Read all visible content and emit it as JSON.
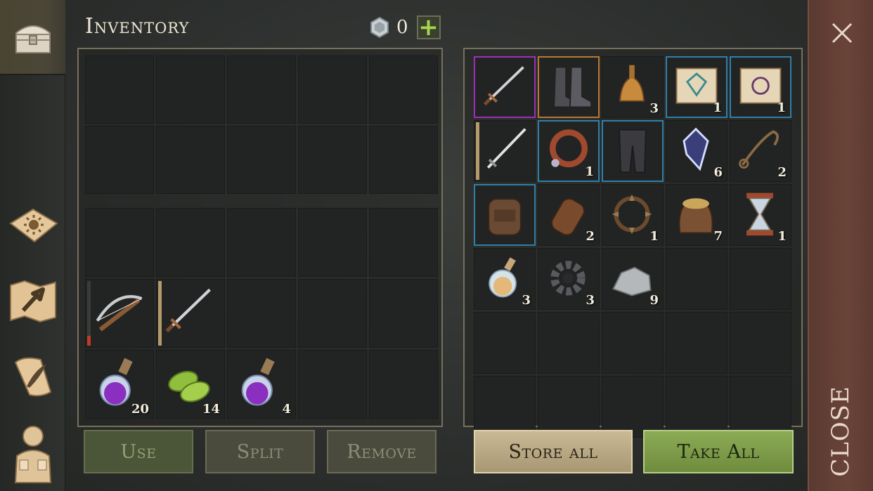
{
  "header": {
    "title": "Inventory",
    "currency_count": "0",
    "add_currency_symbol": "+"
  },
  "sidebar": {
    "items": [
      {
        "name": "inventory",
        "icon": "chest-icon",
        "active": true
      },
      {
        "name": "skills",
        "icon": "sun-book-icon",
        "active": false
      },
      {
        "name": "map",
        "icon": "map-arrow-icon",
        "active": false
      },
      {
        "name": "quests",
        "icon": "scroll-quill-icon",
        "active": false
      },
      {
        "name": "character",
        "icon": "character-icon",
        "active": false
      }
    ]
  },
  "player_inventory": {
    "equip_rows": [
      [
        null,
        null,
        null,
        null,
        null
      ],
      [
        null,
        null,
        null,
        null,
        null
      ]
    ],
    "bag_rows": [
      [
        null,
        null,
        null,
        null,
        null
      ],
      [
        {
          "item": "crossbow",
          "icon": "crossbow-icon",
          "qty": ""
        },
        {
          "item": "sword",
          "icon": "sword-icon",
          "qty": ""
        },
        null,
        null,
        null
      ],
      [
        {
          "item": "purple potion",
          "icon": "purple-potion-icon",
          "qty": "20"
        },
        {
          "item": "herb leaves",
          "icon": "herb-icon",
          "qty": "14"
        },
        {
          "item": "purple potion",
          "icon": "purple-potion-icon",
          "qty": "4"
        },
        null,
        null
      ]
    ]
  },
  "container": {
    "rows": [
      [
        {
          "icon": "sword-icon",
          "qty": "",
          "rarity": "purple"
        },
        {
          "icon": "boots-icon",
          "qty": "",
          "rarity": "orange"
        },
        {
          "icon": "bell-icon",
          "qty": "3",
          "rarity": ""
        },
        {
          "icon": "rune-scroll-icon",
          "qty": "1",
          "rarity": "blue"
        },
        {
          "icon": "map-scroll-icon",
          "qty": "1",
          "rarity": "blue"
        }
      ],
      [
        {
          "icon": "longsword-icon",
          "qty": "",
          "rarity": "tan"
        },
        {
          "icon": "collar-icon",
          "qty": "1",
          "rarity": "blue"
        },
        {
          "icon": "leggings-icon",
          "qty": "",
          "rarity": "blue"
        },
        {
          "icon": "crystal-icon",
          "qty": "6",
          "rarity": ""
        },
        {
          "icon": "rope-icon",
          "qty": "2",
          "rarity": ""
        }
      ],
      [
        {
          "icon": "backpack-icon",
          "qty": "",
          "rarity": "blue"
        },
        {
          "icon": "flask-icon",
          "qty": "2",
          "rarity": ""
        },
        {
          "icon": "bear-trap-icon",
          "qty": "1",
          "rarity": ""
        },
        {
          "icon": "grain-sack-icon",
          "qty": "7",
          "rarity": ""
        },
        {
          "icon": "hourglass-icon",
          "qty": "1",
          "rarity": ""
        }
      ],
      [
        {
          "icon": "gold-potion-icon",
          "qty": "3",
          "rarity": ""
        },
        {
          "icon": "gear-icon",
          "qty": "3",
          "rarity": ""
        },
        {
          "icon": "ore-icon",
          "qty": "9",
          "rarity": ""
        },
        null,
        null
      ],
      [
        null,
        null,
        null,
        null,
        null
      ],
      [
        null,
        null,
        null,
        null,
        null
      ]
    ]
  },
  "buttons": {
    "use": "Use",
    "split": "Split",
    "remove": "Remove",
    "store_all": "Store all",
    "take_all": "Take All"
  },
  "close": {
    "label": "CLOSE"
  },
  "colors": {
    "rarity_purple": "#9c2fb9",
    "rarity_orange": "#b9792f",
    "rarity_blue": "#2f7fa8",
    "take_green": "#7d9b49",
    "store_tan": "#b9a983"
  }
}
